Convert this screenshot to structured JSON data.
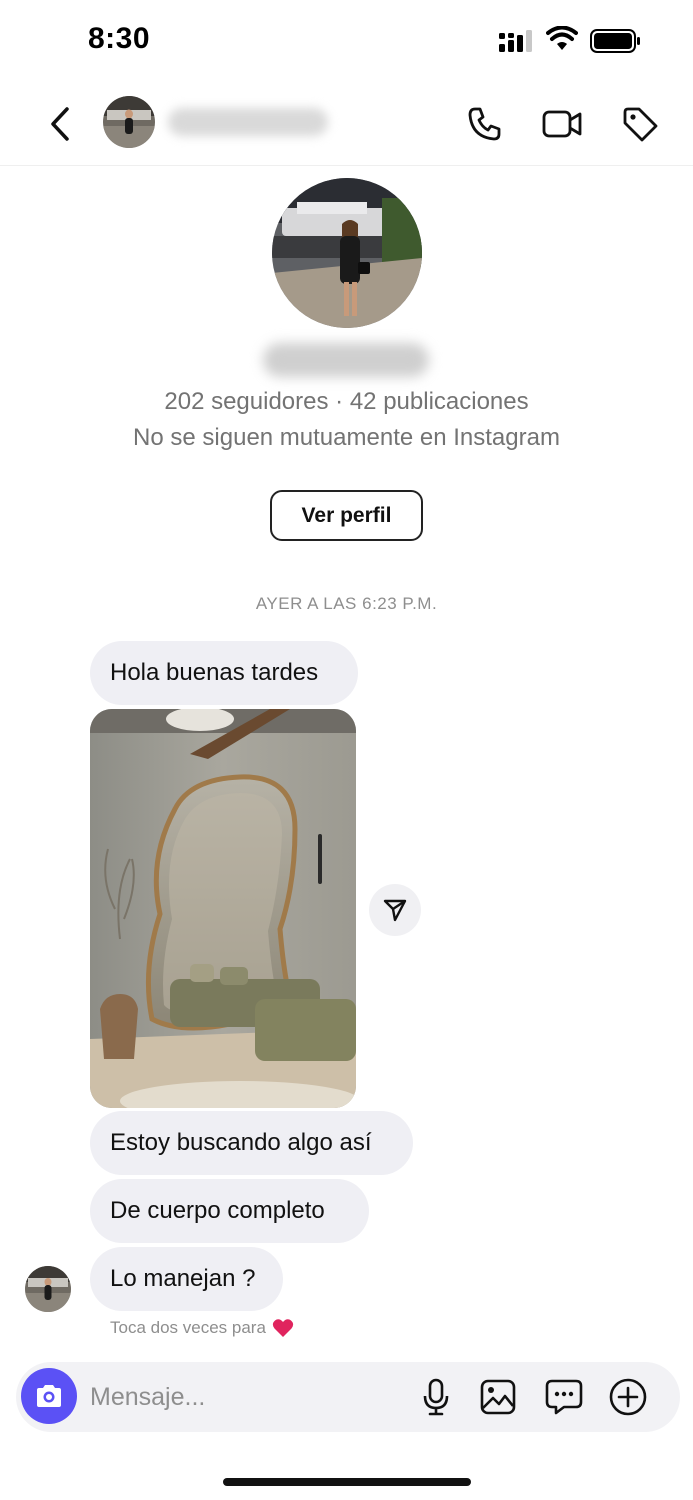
{
  "status_bar": {
    "time": "8:30"
  },
  "header": {
    "back_icon": "chevron-left-icon",
    "icons": [
      "phone-icon",
      "video-camera-icon",
      "tag-icon"
    ]
  },
  "profile": {
    "stats": "202 seguidores · 42 publicaciones",
    "mutual": "No se siguen mutuamente en Instagram",
    "view_profile_label": "Ver perfil"
  },
  "thread": {
    "timestamp": "AYER A LAS 6:23 P.M.",
    "messages": [
      {
        "text": "Hola buenas tardes"
      },
      {
        "type": "image",
        "description": ""
      },
      {
        "text": "Estoy buscando algo así"
      },
      {
        "text": "De cuerpo completo"
      },
      {
        "text": "Lo manejan ?"
      }
    ],
    "hint": "Toca dos veces para",
    "hint_icon": "heart-icon"
  },
  "composer": {
    "placeholder": "Mensaje...",
    "icons": [
      "camera-icon",
      "microphone-icon",
      "gallery-icon",
      "sticker-chat-icon",
      "plus-icon"
    ]
  },
  "colors": {
    "accent": "#5b51f5",
    "bubble": "#efeff4",
    "secondary_text": "#737373",
    "heart": "#e0245e"
  }
}
